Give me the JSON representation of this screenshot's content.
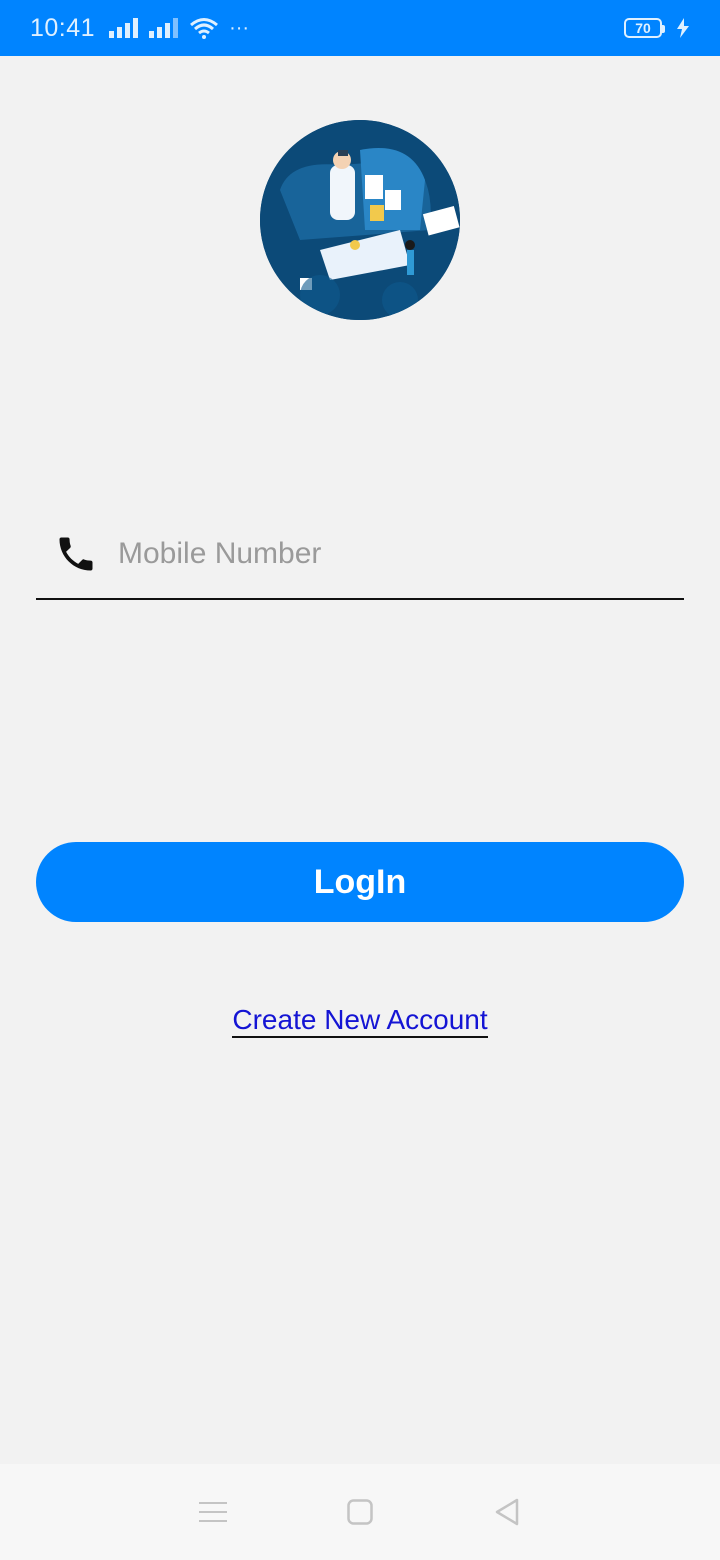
{
  "status_bar": {
    "time": "10:41",
    "battery": "70",
    "more": "···",
    "color": "#0084ff"
  },
  "logo": {
    "icon": "doctor-illustration-icon"
  },
  "form": {
    "mobile_placeholder": "Mobile Number",
    "mobile_value": "",
    "phone_icon": "phone-icon",
    "login_label": "LogIn",
    "create_account_label": "Create New Account"
  },
  "nav": {
    "menu_icon": "menu-icon",
    "home_icon": "home-square-icon",
    "back_icon": "back-triangle-icon"
  },
  "colors": {
    "accent": "#0084ff",
    "link": "#1414d4",
    "background": "#f2f2f2"
  }
}
